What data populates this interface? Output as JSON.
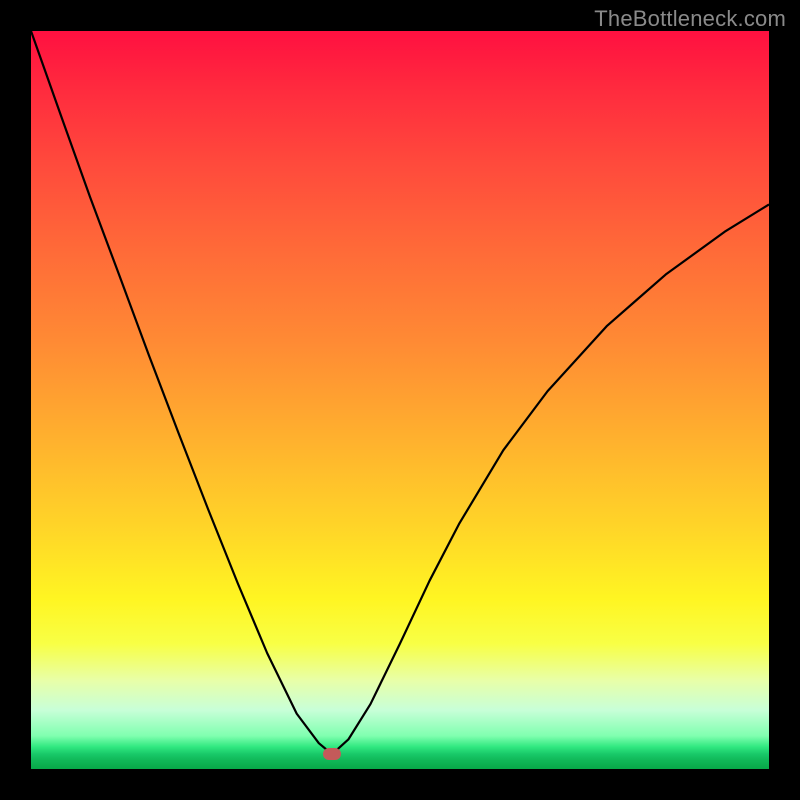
{
  "watermark": {
    "text": "TheBottleneck.com"
  },
  "chart_data": {
    "type": "line",
    "title": "",
    "xlabel": "",
    "ylabel": "",
    "xlim": [
      0,
      1
    ],
    "ylim": [
      0,
      1
    ],
    "background": "vertical_gradient_red_to_green",
    "marker": {
      "x": 0.408,
      "y": 0.98,
      "color": "#c45a5a"
    },
    "series": [
      {
        "name": "curve",
        "x": [
          0.0,
          0.04,
          0.08,
          0.12,
          0.16,
          0.2,
          0.24,
          0.28,
          0.32,
          0.36,
          0.39,
          0.408,
          0.43,
          0.46,
          0.5,
          0.54,
          0.58,
          0.64,
          0.7,
          0.78,
          0.86,
          0.94,
          1.0
        ],
        "y": [
          0.0,
          0.113,
          0.225,
          0.332,
          0.44,
          0.545,
          0.648,
          0.748,
          0.843,
          0.925,
          0.965,
          0.98,
          0.96,
          0.912,
          0.83,
          0.745,
          0.668,
          0.568,
          0.488,
          0.4,
          0.33,
          0.272,
          0.235
        ]
      }
    ]
  }
}
